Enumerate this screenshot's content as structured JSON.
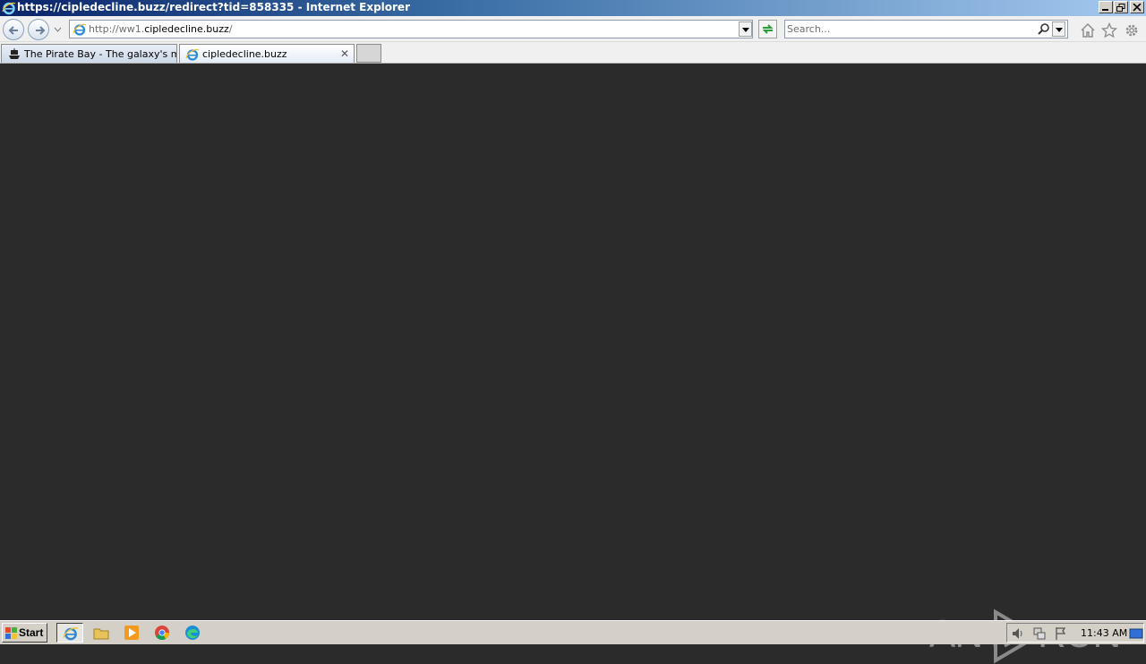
{
  "window": {
    "title": "https://cipledecline.buzz/redirect?tid=858335 - Internet Explorer"
  },
  "address_bar": {
    "url_prefix": "http://ww1.",
    "url_domain": "cipledecline.buzz",
    "url_suffix": "/"
  },
  "search": {
    "placeholder": "Search..."
  },
  "tabs": [
    {
      "label": "The Pirate Bay - The galaxy's m...",
      "active": false,
      "icon": "pirate-ship-icon"
    },
    {
      "label": "cipledecline.buzz",
      "active": true,
      "icon": "ie-icon"
    }
  ],
  "watermark": {
    "left": "ANY",
    "right": "RUN"
  },
  "taskbar": {
    "start_label": "Start",
    "items": [
      "ie-icon",
      "folder-icon",
      "media-player-icon",
      "chrome-icon",
      "edge-icon"
    ],
    "clock": "11:43 AM"
  },
  "colors": {
    "page_background": "#2b2b2b",
    "titlebar_start": "#0a246a",
    "titlebar_end": "#a6caf0"
  }
}
